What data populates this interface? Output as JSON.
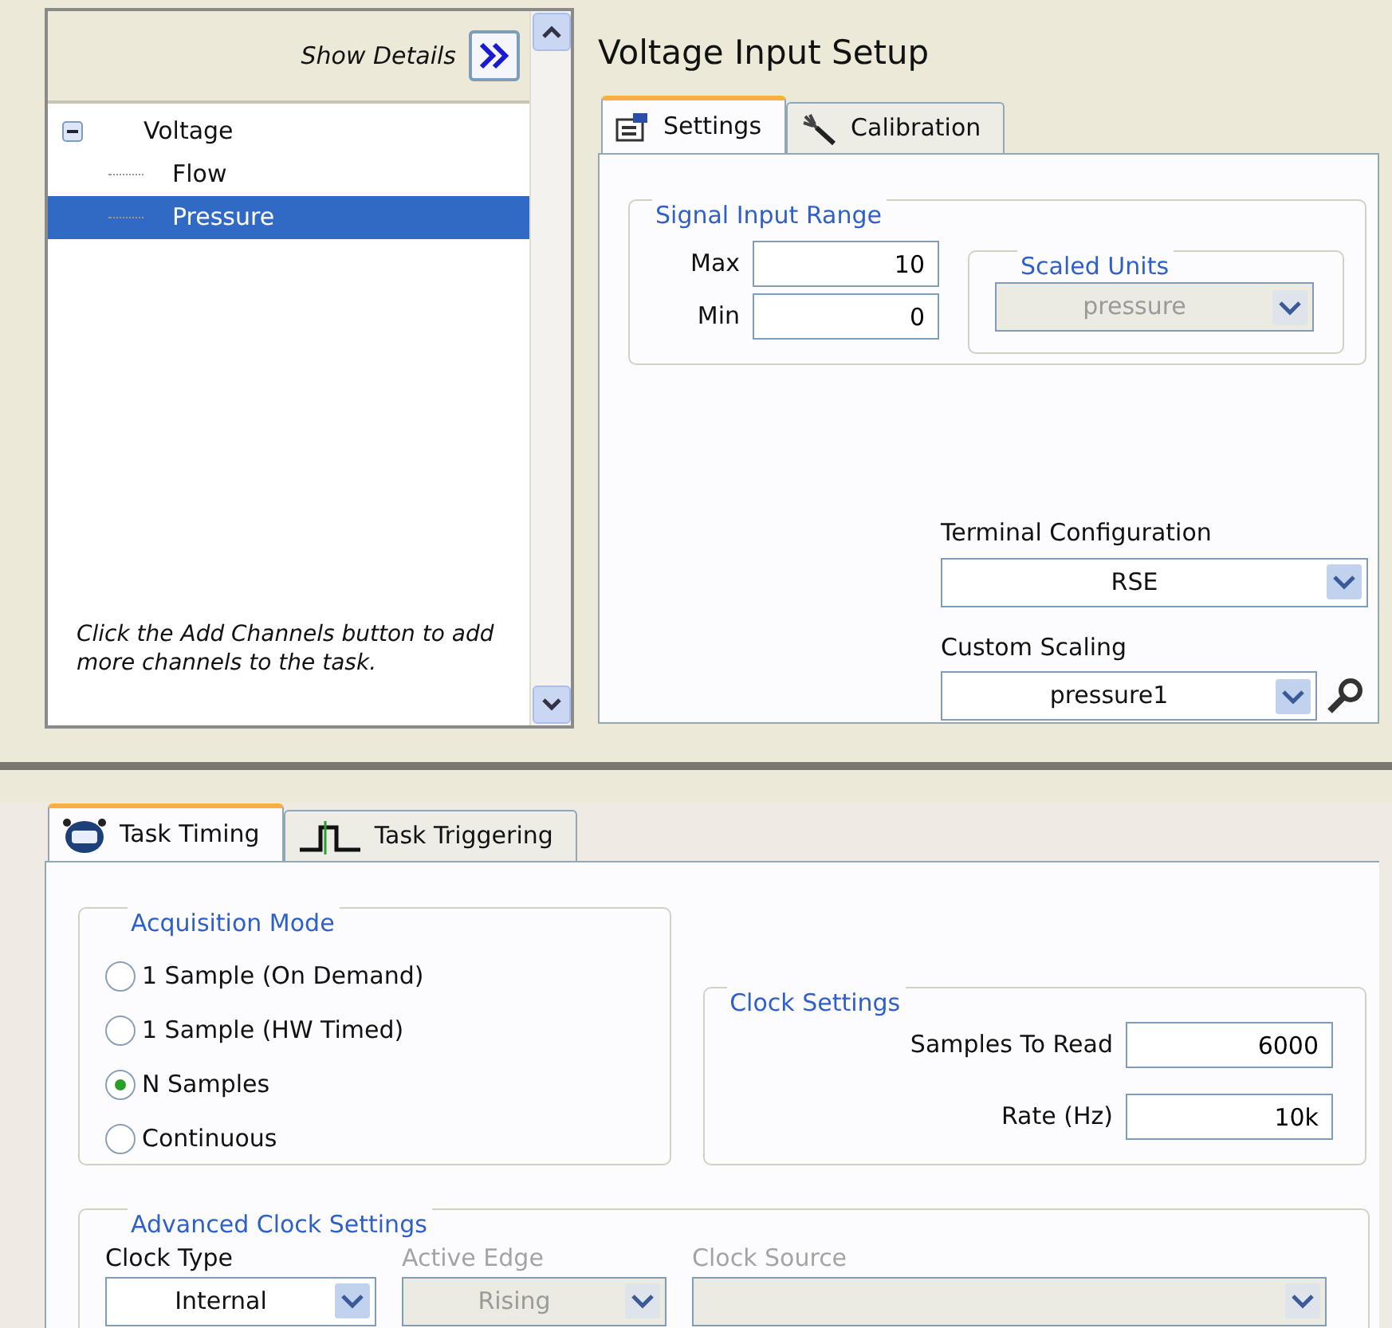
{
  "channel_list": {
    "show_details_label": "Show Details",
    "tree": [
      {
        "label": "Voltage",
        "expanded": true,
        "selected": false,
        "children": [
          {
            "label": "Flow",
            "selected": false
          },
          {
            "label": "Pressure",
            "selected": true
          }
        ]
      }
    ],
    "hint": "Click the Add Channels button to add more channels to the task."
  },
  "setup": {
    "title": "Voltage Input Setup",
    "tabs": [
      {
        "label": "Settings",
        "kind": "settings",
        "selected": true
      },
      {
        "label": "Calibration",
        "kind": "calibration",
        "selected": false
      }
    ],
    "signal_input_range": {
      "title": "Signal Input Range",
      "fields": [
        {
          "label": "Max",
          "value": "10"
        },
        {
          "label": "Min",
          "value": "0"
        }
      ]
    },
    "scaled_units": {
      "title": "Scaled Units",
      "value": "pressure",
      "disabled": true
    },
    "terminal_configuration": {
      "label": "Terminal Configuration",
      "value": "RSE"
    },
    "custom_scaling": {
      "label": "Custom Scaling",
      "value": "pressure1"
    }
  },
  "timing": {
    "tabs": [
      {
        "label": "Task Timing",
        "kind": "timing",
        "selected": true
      },
      {
        "label": "Task Triggering",
        "kind": "triggering",
        "selected": false
      }
    ],
    "acquisition_mode": {
      "title": "Acquisition Mode",
      "options": [
        {
          "label": "1 Sample (On Demand)",
          "selected": false
        },
        {
          "label": "1 Sample (HW Timed)",
          "selected": false
        },
        {
          "label": "N Samples",
          "selected": true
        },
        {
          "label": "Continuous",
          "selected": false
        }
      ]
    },
    "clock_settings": {
      "title": "Clock Settings",
      "fields": [
        {
          "label": "Samples To Read",
          "value": "6000"
        },
        {
          "label": "Rate (Hz)",
          "value": "10k"
        }
      ]
    },
    "advanced_clock_settings": {
      "title": "Advanced Clock Settings",
      "fields": [
        {
          "label": "Clock Type",
          "value": "Internal",
          "disabled": false
        },
        {
          "label": "Active Edge",
          "value": "Rising",
          "disabled": true
        },
        {
          "label": "Clock Source",
          "disabled": true
        }
      ]
    }
  }
}
